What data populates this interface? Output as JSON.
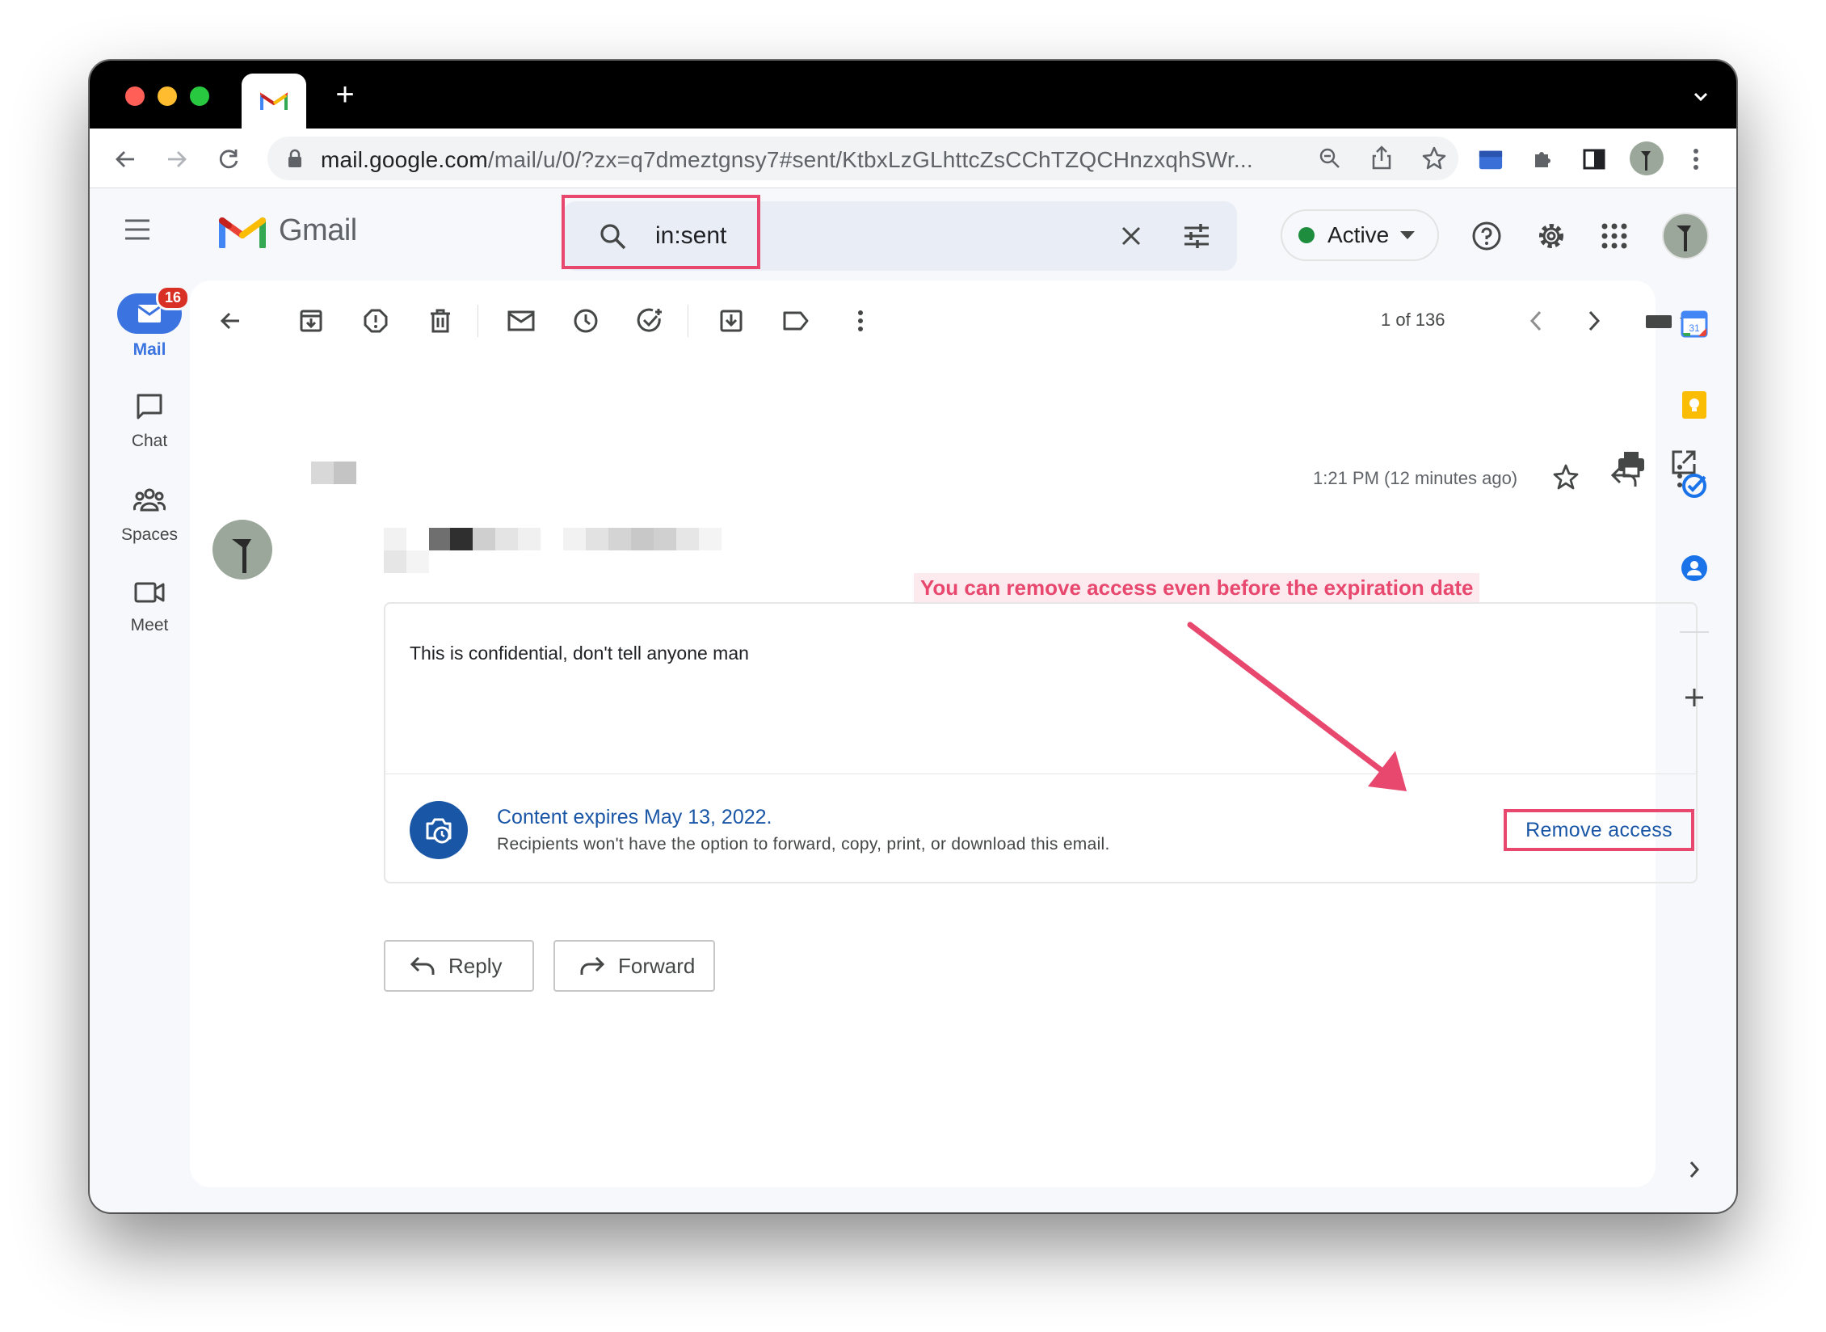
{
  "browser": {
    "tab_title": "Gmail",
    "url_host": "mail.google.com",
    "url_path": "/mail/u/0/?zx=q7dmeztgnsy7#sent/KtbxLzGLhttcZsCChTZQCHnzxqhSWr..."
  },
  "gmail": {
    "brand": "Gmail",
    "search": {
      "query": "in:sent"
    },
    "status": {
      "label": "Active",
      "color": "#1e8e3e"
    }
  },
  "rail": {
    "mail": {
      "label": "Mail",
      "badge": "16"
    },
    "chat": {
      "label": "Chat"
    },
    "spaces": {
      "label": "Spaces"
    },
    "meet": {
      "label": "Meet"
    }
  },
  "toolbar": {
    "counter": "1 of 136"
  },
  "message": {
    "timestamp": "1:21 PM (12 minutes ago)",
    "body": "This is confidential, don't tell anyone man",
    "expiry_title": "Content expires May 13, 2022.",
    "expiry_subtitle": "Recipients won't have the option to forward, copy, print, or download this email.",
    "remove_access_label": "Remove access",
    "reply_label": "Reply",
    "forward_label": "Forward"
  },
  "annotation": {
    "callout_text": "You can remove access even before the expiration date",
    "color": "#e8476e"
  },
  "colors": {
    "accent": "#1a56a6",
    "mail_pill": "#3b73e0",
    "badge": "#d93025"
  }
}
